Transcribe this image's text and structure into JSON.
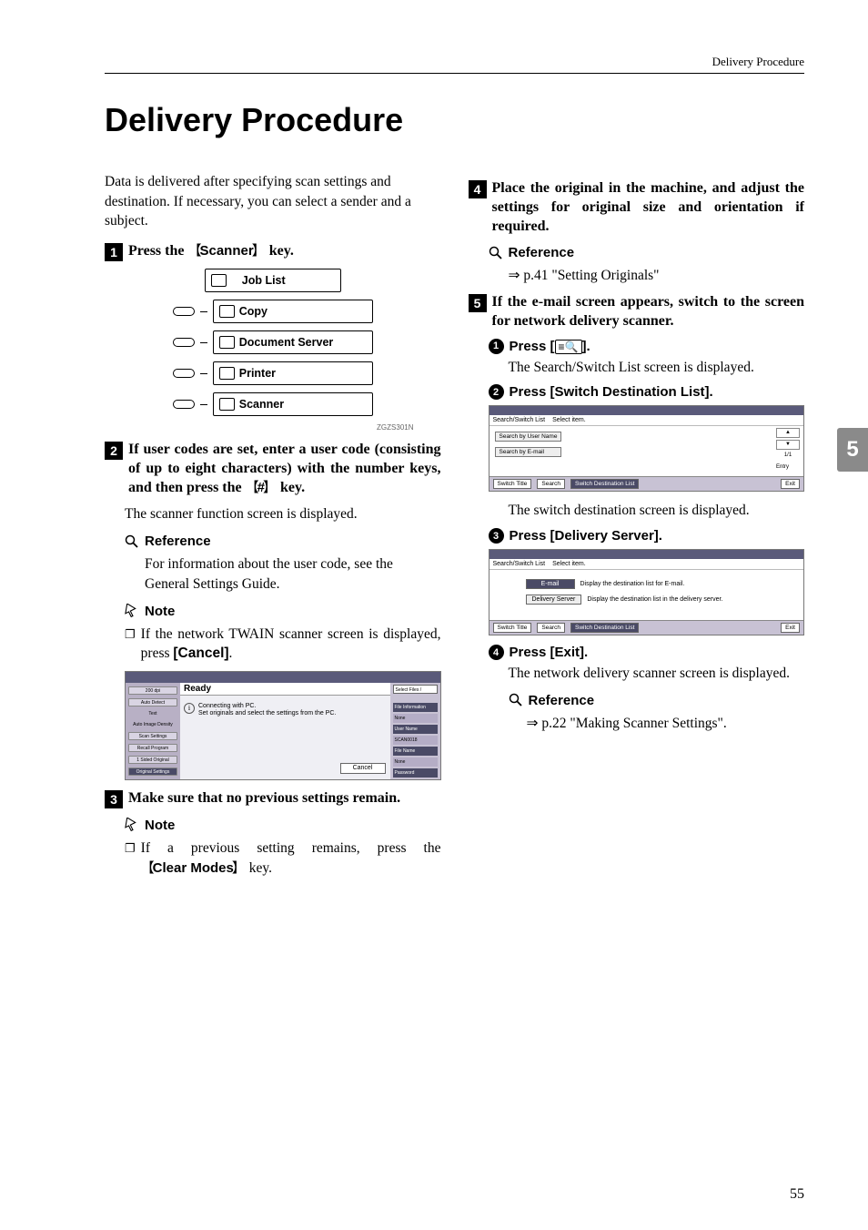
{
  "header": {
    "breadcrumb": "Delivery Procedure"
  },
  "title": "Delivery Procedure",
  "intro": "Data is delivered after specifying scan settings and destination. If necessary, you can select a sender and a subject.",
  "steps": {
    "s1_pre": "Press the ",
    "s1_key": "Scanner",
    "s1_post": " key.",
    "s2": "If user codes are set, enter a user code (consisting of up to eight characters) with the number keys, and then press the ",
    "s2_key": "#",
    "s2_post": " key.",
    "s2_body": "The scanner function screen is displayed.",
    "s3": "Make sure that no previous settings remain.",
    "s4": "Place the original in the machine, and adjust the settings for original size and orientation if required.",
    "s5": "If the e-mail screen appears, switch to the screen for network delivery scanner."
  },
  "subheads": {
    "reference": "Reference",
    "note": "Note"
  },
  "ref1": "For information about the user code, see the General Settings Guide.",
  "note1_pre": "If the network TWAIN scanner screen is displayed, press ",
  "note1_key": "[Cancel]",
  "note1_post": ".",
  "note2_pre": "If a previous setting remains, press the ",
  "note2_key": "Clear Modes",
  "note2_post": " key.",
  "ref2_pre": "⇒ p.41 \"Setting Originals\"",
  "substeps": {
    "a_pre": "Press [",
    "a_post": "].",
    "a_body": "The Search/Switch List screen is displayed.",
    "b": "Press ",
    "b_key": "[Switch Destination List].",
    "b_body": "The switch destination screen is displayed.",
    "c": "Press ",
    "c_key": "[Delivery Server].",
    "d": "Press ",
    "d_key": "[Exit].",
    "d_body": "The network delivery scanner screen is displayed.",
    "ref3": "⇒ p.22 \"Making Scanner Settings\"."
  },
  "device_keys": {
    "joblist": "Job List",
    "copy": "Copy",
    "docserver": "Document Server",
    "printer": "Printer",
    "scanner": "Scanner",
    "caption": "ZGZS301N"
  },
  "screenshot1": {
    "ready": "Ready",
    "center1": "Connecting with PC.",
    "center2": "Set originals and select the settings from the PC.",
    "cancel": "Cancel",
    "left": [
      "200 dpi",
      "Auto Detect",
      "Text",
      "Auto Image Density",
      "Scan Settings",
      "Recall Program",
      "1 Sided Original",
      "Original Settings"
    ],
    "right": [
      "Select Files / Manage",
      "File Information",
      "None",
      "User Name",
      "SCAN0018",
      "File Name",
      "None",
      "Password"
    ]
  },
  "screenshot2": {
    "title_left": "Search/Switch List",
    "select": "Select item.",
    "btn1": "Search by User Name",
    "btn2": "Search by E-mail",
    "scroll": [
      "▲",
      "▼",
      "1/1",
      "Entry"
    ],
    "bottom": [
      "Switch Title",
      "Search",
      "Switch Destination List",
      "Exit"
    ]
  },
  "screenshot3": {
    "title_left": "Search/Switch List",
    "select": "Select item.",
    "email_btn": "E-mail",
    "email_txt": "Display the destination list for E-mail.",
    "deliv_btn": "Delivery Server",
    "deliv_txt": "Display the destination list in the delivery server.",
    "bottom": [
      "Switch Title",
      "Search",
      "Switch Destination List",
      "Exit"
    ]
  },
  "side_tab": "5",
  "page_number": "55"
}
